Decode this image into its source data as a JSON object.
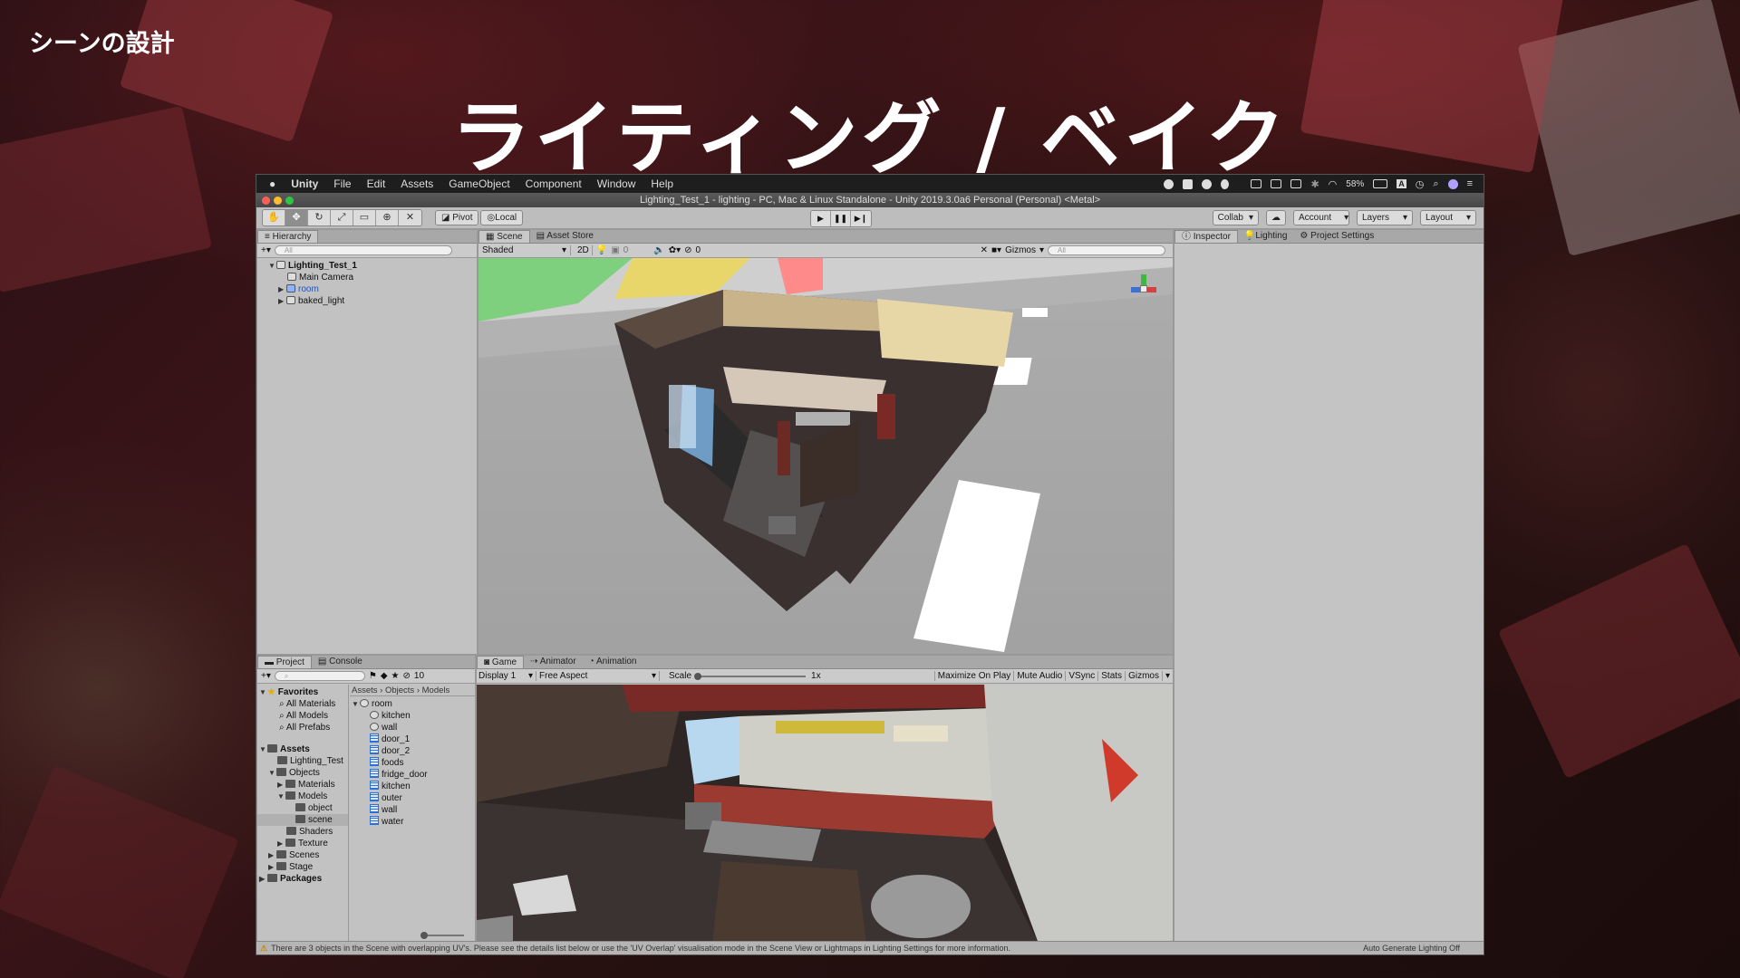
{
  "slide": {
    "corner_label": "シーンの設計",
    "title": "ライティング / ベイク"
  },
  "macos_menubar": {
    "app": "Unity",
    "items": [
      "File",
      "Edit",
      "Assets",
      "GameObject",
      "Component",
      "Window",
      "Help"
    ],
    "battery": "58%",
    "input_indicator": "A"
  },
  "window": {
    "title": "Lighting_Test_1 - lighting - PC, Mac & Linux Standalone - Unity 2019.3.0a6 Personal (Personal) <Metal>"
  },
  "toolbar": {
    "pivot": "Pivot",
    "local": "Local",
    "collab": "Collab",
    "account": "Account",
    "layers": "Layers",
    "layout": "Layout"
  },
  "hierarchy": {
    "tab": "Hierarchy",
    "search_placeholder": "All",
    "scene": "Lighting_Test_1",
    "items": [
      "Main Camera",
      "room",
      "baked_light"
    ]
  },
  "scene_view": {
    "tabs": [
      "Scene",
      "Asset Store"
    ],
    "shading": "Shaded",
    "mode_2d": "2D",
    "effects_count": "0",
    "hidden_count": "0",
    "gizmos": "Gizmos",
    "search_placeholder": "All"
  },
  "inspector": {
    "tabs": [
      "Inspector",
      "Lighting",
      "Project Settings"
    ]
  },
  "project": {
    "tabs": [
      "Project",
      "Console"
    ],
    "hidden_count": "10",
    "favorites_label": "Favorites",
    "favorites": [
      "All Materials",
      "All Models",
      "All Prefabs"
    ],
    "assets_label": "Assets",
    "tree": [
      "Lighting_Test",
      "Objects",
      "Materials",
      "Models",
      "object",
      "scene",
      "Shaders",
      "Texture",
      "Scenes",
      "Stage"
    ],
    "packages_label": "Packages",
    "breadcrumb": [
      "Assets",
      "Objects",
      "Models"
    ],
    "root_asset": "room",
    "assets": [
      "kitchen",
      "wall",
      "door_1",
      "door_2",
      "foods",
      "fridge_door",
      "kitchen",
      "outer",
      "wall",
      "water"
    ]
  },
  "game_view": {
    "tabs": [
      "Game",
      "Animator",
      "Animation"
    ],
    "display": "Display 1",
    "aspect": "Free Aspect",
    "scale_label": "Scale",
    "scale_value": "1x",
    "options": [
      "Maximize On Play",
      "Mute Audio",
      "VSync",
      "Stats",
      "Gizmos"
    ]
  },
  "status": {
    "message": "There are 3 objects in the Scene with overlapping UV's. Please see the details list below or use the 'UV Overlap' visualisation mode in the Scene View or Lightmaps in Lighting Settings for more information.",
    "right": "Auto Generate Lighting Off"
  }
}
